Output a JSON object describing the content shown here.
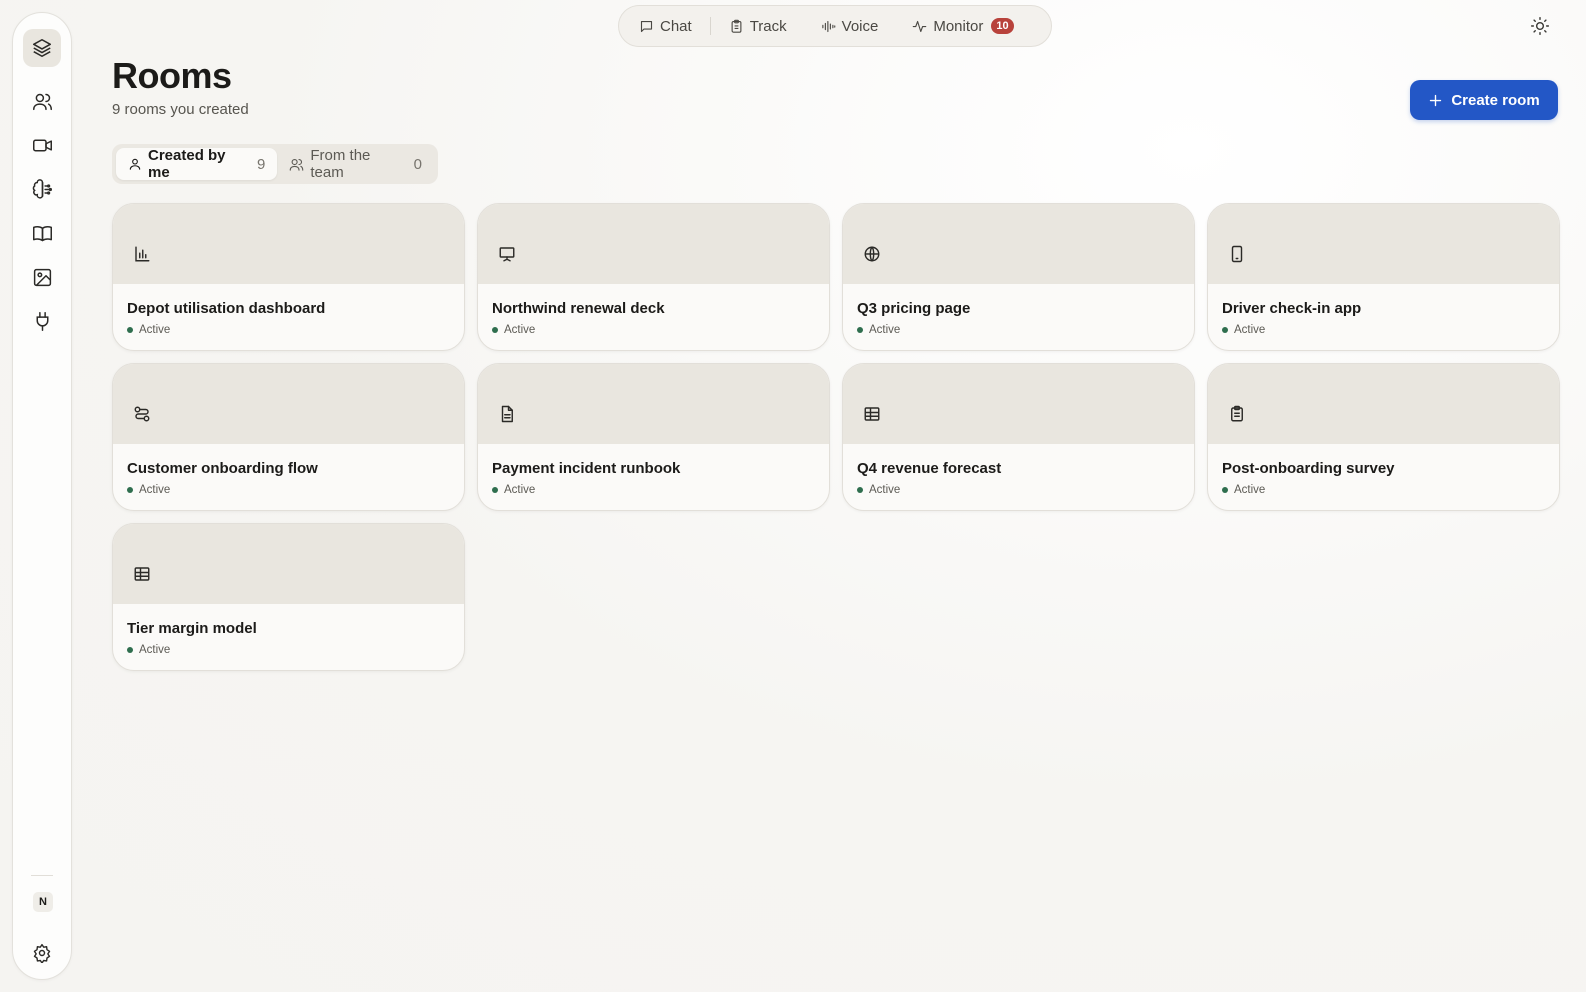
{
  "nav": {
    "items": [
      {
        "label": "Chat",
        "icon": "chat-bubble-icon"
      },
      {
        "label": "Track",
        "icon": "clipboard-icon"
      },
      {
        "label": "Voice",
        "icon": "waveform-icon"
      },
      {
        "label": "Monitor",
        "icon": "activity-icon",
        "badge": "10"
      }
    ]
  },
  "sidebar": {
    "items": [
      {
        "name": "layers-icon"
      },
      {
        "name": "users-icon"
      },
      {
        "name": "video-icon"
      },
      {
        "name": "brain-icon"
      },
      {
        "name": "book-icon"
      },
      {
        "name": "image-icon"
      },
      {
        "name": "plug-icon"
      }
    ],
    "avatar": "N"
  },
  "header": {
    "title": "Rooms",
    "subtitle": "9 rooms you created",
    "create_label": "Create room"
  },
  "filters": [
    {
      "label": "Created by me",
      "count": "9"
    },
    {
      "label": "From the team",
      "count": "0"
    }
  ],
  "rooms": [
    {
      "title": "Depot utilisation dashboard",
      "status": "Active",
      "icon": "bar-chart-icon"
    },
    {
      "title": "Northwind renewal deck",
      "status": "Active",
      "icon": "presentation-icon"
    },
    {
      "title": "Q3 pricing page",
      "status": "Active",
      "icon": "globe-icon"
    },
    {
      "title": "Driver check-in app",
      "status": "Active",
      "icon": "smartphone-icon"
    },
    {
      "title": "Customer onboarding flow",
      "status": "Active",
      "icon": "workflow-icon"
    },
    {
      "title": "Payment incident runbook",
      "status": "Active",
      "icon": "document-icon"
    },
    {
      "title": "Q4 revenue forecast",
      "status": "Active",
      "icon": "table-icon"
    },
    {
      "title": "Post-onboarding survey",
      "status": "Active",
      "icon": "clipboard-list-icon"
    },
    {
      "title": "Tier margin model",
      "status": "Active",
      "icon": "table-icon"
    }
  ],
  "colors": {
    "accent": "#2357c6",
    "badge": "#b8423b",
    "status_active": "#2f6e4e",
    "card_header": "#e9e6df"
  }
}
